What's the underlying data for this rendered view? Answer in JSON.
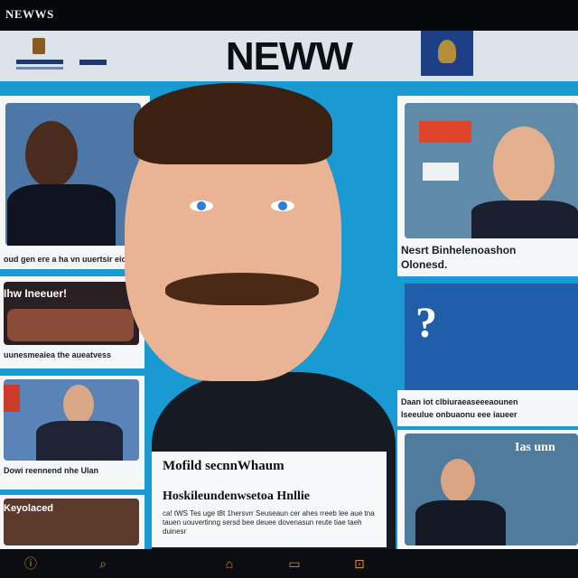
{
  "topbar": {
    "brand": "NEWWS"
  },
  "header": {
    "title": "NEWW"
  },
  "article": {
    "headline": "Mofild secnnWhaum",
    "subhead": "Hoskileundenwsetoa Hnllie",
    "body": "ca! tWS Tes uge t8t 1hersvrr Seuseaun cer ahes rreeb lee aue tna tauen uouvertinng sersd bee deuee dovenasun reute tiae taeh duinesr"
  },
  "left_cards": [
    {
      "caption": "oud gen ere a ha vn uuertsir eicoes"
    },
    {
      "caption": "Ihw Ineeuer!"
    },
    {
      "caption": "uunesmeaiea the aueatvess"
    },
    {
      "caption": "Dowi reennend nhe Ulan"
    },
    {
      "caption": "Keyolaced"
    }
  ],
  "right_cards": [
    {
      "caption": "Nesrt Binhelenoashon",
      "caption2": "Olonesd."
    },
    {
      "caption": "?"
    },
    {
      "caption": "Daan iot clbiuraeaseeeaounen"
    },
    {
      "caption": "Iseeulue onbuaonu eee iaueer"
    },
    {
      "caption": "Ias unn"
    }
  ],
  "nav": {
    "icons": [
      "info-icon",
      "search-icon",
      "home-icon",
      "folder-icon",
      "bookmark-icon"
    ]
  }
}
